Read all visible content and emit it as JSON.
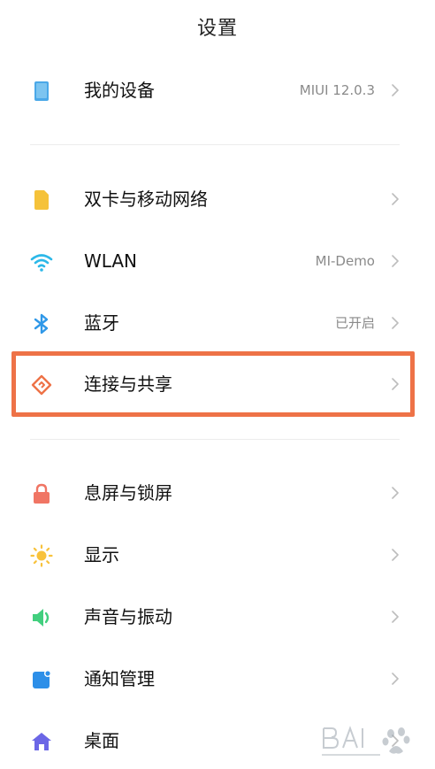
{
  "header": {
    "title": "设置"
  },
  "rows": {
    "device": {
      "label": "我的设备",
      "value": "MIUI 12.0.3",
      "icon": "tablet-icon"
    },
    "sim": {
      "label": "双卡与移动网络",
      "icon": "sim-card-icon"
    },
    "wlan": {
      "label": "WLAN",
      "value": "MI-Demo",
      "icon": "wifi-icon"
    },
    "bluetooth": {
      "label": "蓝牙",
      "value": "已开启",
      "icon": "bluetooth-icon"
    },
    "connect": {
      "label": "连接与共享",
      "icon": "connect-share-icon"
    },
    "lock": {
      "label": "息屏与锁屏",
      "icon": "lock-icon"
    },
    "display": {
      "label": "显示",
      "icon": "sun-icon"
    },
    "sound": {
      "label": "声音与振动",
      "icon": "speaker-icon"
    },
    "notify": {
      "label": "通知管理",
      "icon": "notification-icon"
    },
    "desktop": {
      "label": "桌面",
      "icon": "home-icon"
    }
  },
  "colors": {
    "highlight": "#ee7247",
    "tablet": "#4aa8e8",
    "sim": "#f5c23a",
    "wifi": "#2cb8e8",
    "bluetooth": "#2f98e8",
    "connect": "#ee7247",
    "lock": "#f07564",
    "sun": "#f8c23c",
    "speaker": "#42cf7e",
    "notify": "#2d8fe8",
    "home": "#6b66e6"
  }
}
